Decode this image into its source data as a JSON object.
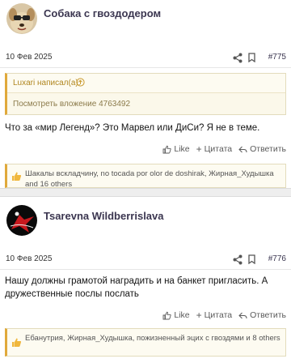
{
  "posts": [
    {
      "author": "Собака с гвоздодером",
      "date": "10 Фев 2025",
      "number": "#775",
      "quote": {
        "author": "Luxari написал(а):",
        "link": "Посмотреть вложение 4763492"
      },
      "text": "Что за «мир Легенд»? Это Марвел или ДиСи? Я не в теме.",
      "actions": {
        "like": "Like",
        "quote": "Цитата",
        "reply": "Ответить"
      },
      "reactions": "Шакалы вскладчину, no tocada por olor de doshirak, Жирная_Худышка and 16 others"
    },
    {
      "author": "Tsarevna Wildberrislava",
      "date": "10 Фев 2025",
      "number": "#776",
      "text": "Нашу должны грамотой наградить и на банкет пригласить. А дружественные послы послать",
      "actions": {
        "like": "Like",
        "quote": "Цитата",
        "reply": "Ответить"
      },
      "reactions": "Ебанутрия, Жирная_Худышка, пожизненный эцих с гвоздями и 8 others"
    }
  ],
  "colors": {
    "accent": "#e0a93b",
    "author": "#3b3650",
    "quote_bg": "#fdfbf1"
  }
}
